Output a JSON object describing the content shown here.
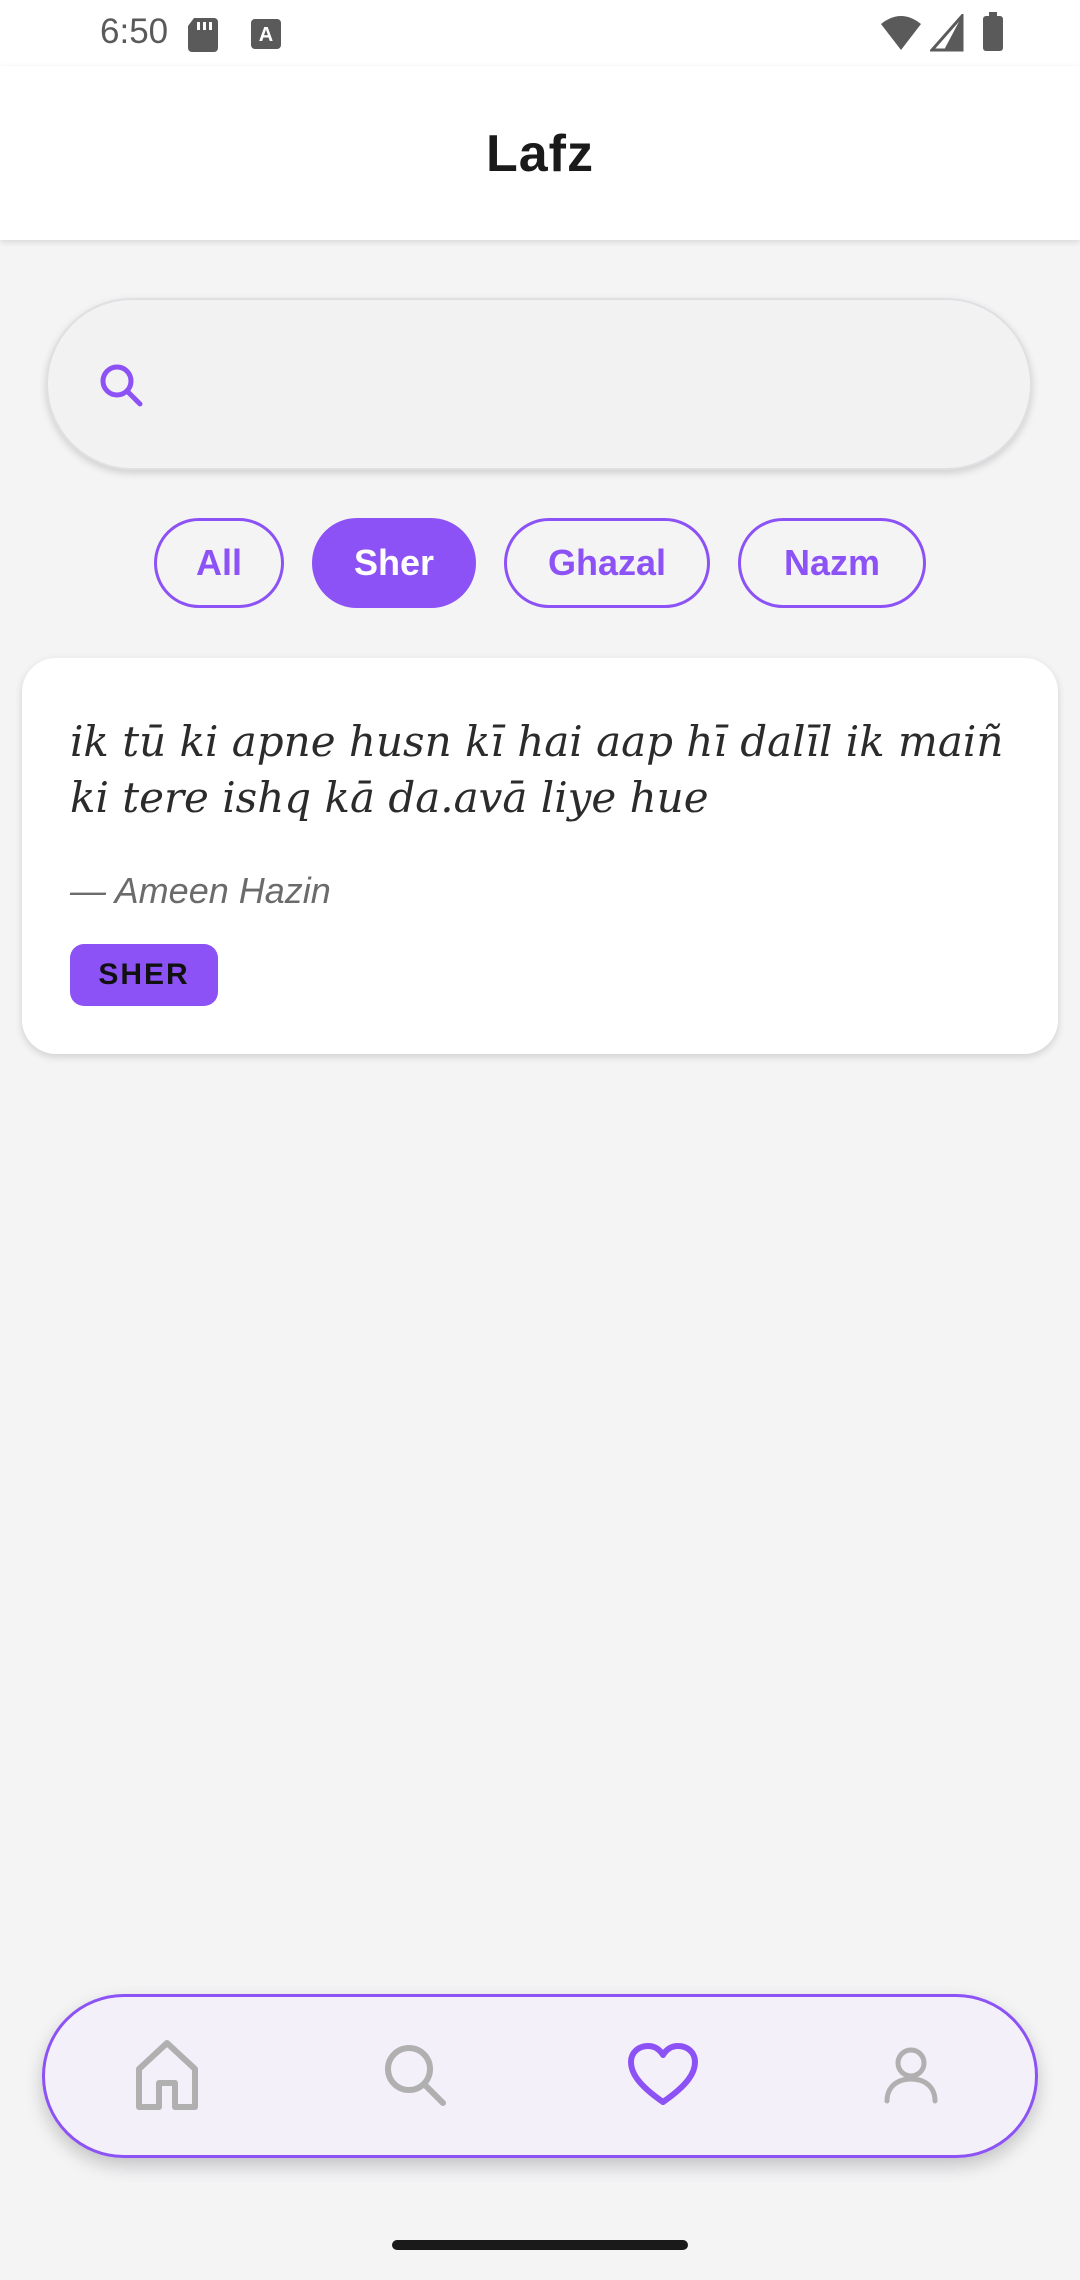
{
  "status_bar": {
    "time": "6:50",
    "icons": [
      "sd-card-icon",
      "keyboard-a-icon",
      "wifi-icon",
      "cell-signal-icon",
      "battery-icon"
    ]
  },
  "header": {
    "title": "Lafz"
  },
  "search": {
    "placeholder": "",
    "value": "",
    "icon": "search-icon"
  },
  "filters": {
    "chips": [
      {
        "label": "All",
        "active": false
      },
      {
        "label": "Sher",
        "active": true
      },
      {
        "label": "Ghazal",
        "active": false
      },
      {
        "label": "Nazm",
        "active": false
      }
    ]
  },
  "results": [
    {
      "text": "ik tū ki apne husn kī hai aap hī dalīl ik maiñ ki tere ishq kā da.avā liye hue",
      "poet": "— Ameen Hazin",
      "tag": "SHER"
    }
  ],
  "bottom_nav": {
    "items": [
      {
        "icon": "home-icon",
        "active": false
      },
      {
        "icon": "search-icon",
        "active": false
      },
      {
        "icon": "heart-icon",
        "active": true
      },
      {
        "icon": "profile-icon",
        "active": false
      }
    ]
  },
  "colors": {
    "accent": "#8c52f5",
    "background": "#f4f4f5",
    "card": "#ffffff",
    "inactive_icon": "#b0b0b0"
  }
}
